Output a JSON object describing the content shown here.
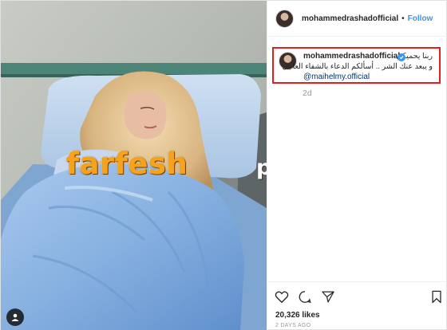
{
  "post": {
    "username": "mohammedrashadofficial",
    "follow_label": "Follow",
    "separator": "•"
  },
  "caption": {
    "username": "mohammedrashadofficial",
    "line1": "ربنا يحميكي",
    "line2": "و يبعد عنك الشر .. أسألكم الدعاء بالشفاء العاجل",
    "mention": "@maihelmy.official",
    "time_ago": "2d"
  },
  "footer": {
    "likes": "20,326 likes",
    "date": "2 DAYS AGO"
  },
  "watermark": {
    "main": "farfesh",
    "tail": "plus.com"
  },
  "icons": {
    "user_tag": "user-tag-icon",
    "verified": "verified-badge-icon",
    "like": "heart-icon",
    "comment": "comment-icon",
    "share": "share-icon",
    "save": "bookmark-icon"
  },
  "colors": {
    "link_blue": "#3897f0",
    "highlight_red": "#e0201d",
    "mention_blue": "#003569",
    "watermark_orange": "#f6a21a",
    "sheet_blue": "#8fb7e6"
  }
}
